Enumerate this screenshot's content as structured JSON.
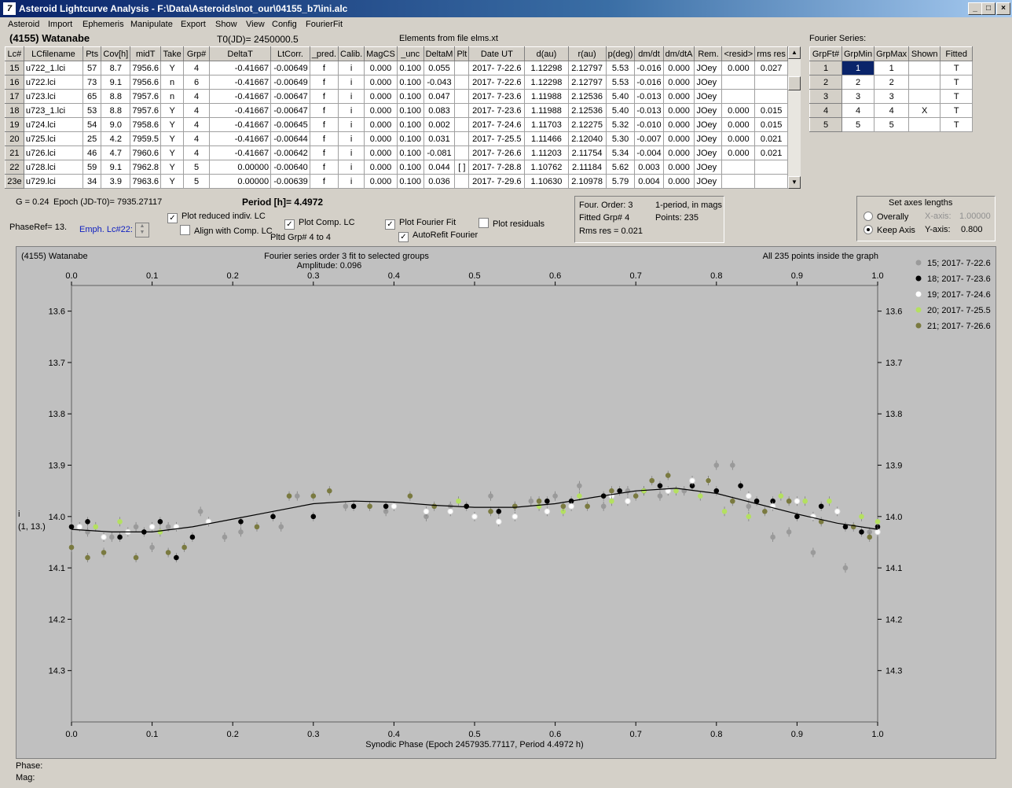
{
  "window": {
    "title": "Asteroid Lightcurve Analysis - F:\\Data\\Asteroids\\not_our\\04155_b7\\ini.alc"
  },
  "menu": [
    "Asteroid",
    "Import",
    "Ephemeris",
    "Manipulate",
    "Export",
    "Show",
    "View",
    "Config",
    "FourierFit"
  ],
  "header": {
    "asteroid_name": "(4155) Watanabe",
    "t0": "T0(JD)= 2450000.5",
    "elements": "Elements from file elms.xt",
    "fourier_label": "Fourier Series:"
  },
  "lc_table": {
    "columns": [
      "Lc#",
      "LCfilename",
      "Pts",
      "Cov[h]",
      "midT",
      "Take",
      "Grp#",
      "DeltaT",
      "LtCorr.",
      "_pred.",
      "Calib.",
      "MagCS",
      "_unc",
      "DeltaM",
      "Plt",
      "Date UT",
      "d(au)",
      "r(au)",
      "p(deg)",
      "dm/dt",
      "dm/dtA",
      "Rem.",
      "<resid>",
      "rms res"
    ],
    "rows": [
      [
        "15",
        "u722_1.lci",
        "57",
        "8.7",
        "7956.6",
        "Y",
        "4",
        "-0.41667",
        "-0.00649",
        "f",
        "i",
        "0.000",
        "0.100",
        "0.055",
        "",
        "2017- 7-22.6",
        "1.12298",
        "2.12797",
        "5.53",
        "-0.016",
        "0.000",
        "JOey",
        "0.000",
        "0.027"
      ],
      [
        "16",
        "u722.lci",
        "73",
        "9.1",
        "7956.6",
        "n",
        "6",
        "-0.41667",
        "-0.00649",
        "f",
        "i",
        "0.000",
        "0.100",
        "-0.043",
        "",
        "2017- 7-22.6",
        "1.12298",
        "2.12797",
        "5.53",
        "-0.016",
        "0.000",
        "JOey",
        "",
        ""
      ],
      [
        "17",
        "u723.lci",
        "65",
        "8.8",
        "7957.6",
        "n",
        "4",
        "-0.41667",
        "-0.00647",
        "f",
        "i",
        "0.000",
        "0.100",
        "0.047",
        "",
        "2017- 7-23.6",
        "1.11988",
        "2.12536",
        "5.40",
        "-0.013",
        "0.000",
        "JOey",
        "",
        ""
      ],
      [
        "18",
        "u723_1.lci",
        "53",
        "8.8",
        "7957.6",
        "Y",
        "4",
        "-0.41667",
        "-0.00647",
        "f",
        "i",
        "0.000",
        "0.100",
        "0.083",
        "",
        "2017- 7-23.6",
        "1.11988",
        "2.12536",
        "5.40",
        "-0.013",
        "0.000",
        "JOey",
        "0.000",
        "0.015"
      ],
      [
        "19",
        "u724.lci",
        "54",
        "9.0",
        "7958.6",
        "Y",
        "4",
        "-0.41667",
        "-0.00645",
        "f",
        "i",
        "0.000",
        "0.100",
        "0.002",
        "",
        "2017- 7-24.6",
        "1.11703",
        "2.12275",
        "5.32",
        "-0.010",
        "0.000",
        "JOey",
        "0.000",
        "0.015"
      ],
      [
        "20",
        "u725.lci",
        "25",
        "4.2",
        "7959.5",
        "Y",
        "4",
        "-0.41667",
        "-0.00644",
        "f",
        "i",
        "0.000",
        "0.100",
        "0.031",
        "",
        "2017- 7-25.5",
        "1.11466",
        "2.12040",
        "5.30",
        "-0.007",
        "0.000",
        "JOey",
        "0.000",
        "0.021"
      ],
      [
        "21",
        "u726.lci",
        "46",
        "4.7",
        "7960.6",
        "Y",
        "4",
        "-0.41667",
        "-0.00642",
        "f",
        "i",
        "0.000",
        "0.100",
        "-0.081",
        "",
        "2017- 7-26.6",
        "1.11203",
        "2.11754",
        "5.34",
        "-0.004",
        "0.000",
        "JOey",
        "0.000",
        "0.021"
      ],
      [
        "22",
        "u728.lci",
        "59",
        "9.1",
        "7962.8",
        "Y",
        "5",
        "0.00000",
        "-0.00640",
        "f",
        "i",
        "0.000",
        "0.100",
        "0.044",
        "[ ]",
        "2017- 7-28.8",
        "1.10762",
        "2.11184",
        "5.62",
        "0.003",
        "0.000",
        "JOey",
        "",
        ""
      ],
      [
        "23e",
        "u729.lci",
        "34",
        "3.9",
        "7963.6",
        "Y",
        "5",
        "0.00000",
        "-0.00639",
        "f",
        "i",
        "0.000",
        "0.100",
        "0.036",
        "",
        "2017- 7-29.6",
        "1.10630",
        "2.10978",
        "5.79",
        "0.004",
        "0.000",
        "JOey",
        "",
        ""
      ]
    ]
  },
  "fourier_table": {
    "columns": [
      "GrpFt#",
      "GrpMin",
      "GrpMax",
      "Shown",
      "Fitted"
    ],
    "rows": [
      [
        "1",
        "1",
        "1",
        "",
        "T"
      ],
      [
        "2",
        "2",
        "2",
        "",
        "T"
      ],
      [
        "3",
        "3",
        "3",
        "",
        "T"
      ],
      [
        "4",
        "4",
        "4",
        "X",
        "T"
      ],
      [
        "5",
        "5",
        "5",
        "",
        "T"
      ]
    ]
  },
  "controls": {
    "g": "G = 0.24",
    "epoch": "Epoch (JD-T0)= 7935.27117",
    "period": "Period [h]= 4.4972",
    "phaseref": "PhaseRef= 13.",
    "emph": "Emph. Lc#22:",
    "plot_reduced": "Plot reduced indiv. LC",
    "align_comp": "Align with Comp. LC",
    "plot_comp": "Plot Comp. LC",
    "pltd_grp": "Pltd Grp#  4  to   4",
    "plot_fourier": "Plot Fourier Fit",
    "autorefit": "AutoRefit Fourier",
    "plot_residuals": "Plot residuals",
    "four_order": "Four. Order:  3",
    "one_period": "1-period, in mags",
    "fitted_grp": "Fitted Grp# 4",
    "points": "Points: 235",
    "rms": "Rms res     = 0.021",
    "axes_title": "Set axes lengths",
    "overally": "Overally",
    "keep_axis": "Keep Axis",
    "x_axis_label": "X-axis:",
    "x_axis_value": "1.00000",
    "y_axis_label": "Y-axis:",
    "y_axis_value": "0.800"
  },
  "plot": {
    "name": "(4155) Watanabe",
    "fit_title": "Fourier series order 3 fit to selected groups",
    "amplitude": "Amplitude: 0.096",
    "inside": "All 235 points inside the graph",
    "xlabel": "Synodic Phase (Epoch 2457935.77117, Period 4.4972 h)",
    "ylabel_1": "i",
    "ylabel_2": "(1, 13.)"
  },
  "footer": {
    "phase": "Phase:",
    "mag": "Mag:"
  },
  "colors": {
    "selected": "#0a246a",
    "fit_line": "#000000"
  },
  "chart_data": {
    "type": "scatter",
    "xlim": [
      0,
      1
    ],
    "ylim": [
      14.4,
      13.55
    ],
    "xticks": [
      "0.0",
      "0.1",
      "0.2",
      "0.3",
      "0.4",
      "0.5",
      "0.6",
      "0.7",
      "0.8",
      "0.9",
      "1.0"
    ],
    "yticks": [
      "13.6",
      "13.7",
      "13.8",
      "13.9",
      "14.0",
      "14.1",
      "14.2",
      "14.3"
    ],
    "series": [
      {
        "name": "15; 2017- 7-22.6",
        "color": "#9a9a9a",
        "points": [
          [
            0.02,
            14.03
          ],
          [
            0.05,
            14.04
          ],
          [
            0.08,
            14.02
          ],
          [
            0.1,
            14.06
          ],
          [
            0.12,
            14.02
          ],
          [
            0.16,
            13.99
          ],
          [
            0.19,
            14.04
          ],
          [
            0.21,
            14.03
          ],
          [
            0.26,
            14.02
          ],
          [
            0.28,
            13.96
          ],
          [
            0.34,
            13.98
          ],
          [
            0.39,
            13.99
          ],
          [
            0.44,
            14.0
          ],
          [
            0.47,
            13.98
          ],
          [
            0.52,
            13.96
          ],
          [
            0.55,
            13.98
          ],
          [
            0.57,
            13.97
          ],
          [
            0.6,
            13.96
          ],
          [
            0.63,
            13.94
          ],
          [
            0.66,
            13.98
          ],
          [
            0.69,
            13.95
          ],
          [
            0.73,
            13.96
          ],
          [
            0.76,
            13.95
          ],
          [
            0.8,
            13.9
          ],
          [
            0.82,
            13.9
          ],
          [
            0.84,
            13.98
          ],
          [
            0.87,
            14.04
          ],
          [
            0.89,
            14.03
          ],
          [
            0.92,
            14.07
          ],
          [
            0.96,
            14.1
          ],
          [
            0.99,
            14.03
          ]
        ]
      },
      {
        "name": "18; 2017- 7-23.6",
        "color": "#000000",
        "points": [
          [
            0.0,
            14.02
          ],
          [
            0.02,
            14.01
          ],
          [
            0.06,
            14.04
          ],
          [
            0.09,
            14.03
          ],
          [
            0.11,
            14.01
          ],
          [
            0.13,
            14.08
          ],
          [
            0.15,
            14.04
          ],
          [
            0.21,
            14.01
          ],
          [
            0.25,
            14.0
          ],
          [
            0.3,
            14.0
          ],
          [
            0.35,
            13.98
          ],
          [
            0.39,
            13.98
          ],
          [
            0.49,
            13.98
          ],
          [
            0.53,
            13.99
          ],
          [
            0.59,
            13.97
          ],
          [
            0.62,
            13.97
          ],
          [
            0.66,
            13.96
          ],
          [
            0.68,
            13.95
          ],
          [
            0.71,
            13.95
          ],
          [
            0.73,
            13.94
          ],
          [
            0.77,
            13.94
          ],
          [
            0.8,
            13.95
          ],
          [
            0.83,
            13.94
          ],
          [
            0.85,
            13.97
          ],
          [
            0.87,
            13.97
          ],
          [
            0.9,
            14.0
          ],
          [
            0.93,
            13.98
          ],
          [
            0.96,
            14.02
          ],
          [
            0.98,
            14.03
          ],
          [
            1.0,
            14.02
          ]
        ]
      },
      {
        "name": "19; 2017- 7-24.6",
        "color": "#ffffff",
        "points": [
          [
            0.01,
            14.02
          ],
          [
            0.04,
            14.04
          ],
          [
            0.07,
            14.03
          ],
          [
            0.1,
            14.02
          ],
          [
            0.13,
            14.02
          ],
          [
            0.17,
            14.01
          ],
          [
            0.4,
            13.98
          ],
          [
            0.44,
            13.99
          ],
          [
            0.47,
            13.99
          ],
          [
            0.5,
            14.0
          ],
          [
            0.53,
            14.01
          ],
          [
            0.55,
            14.0
          ],
          [
            0.59,
            13.99
          ],
          [
            0.62,
            13.98
          ],
          [
            0.67,
            13.96
          ],
          [
            0.69,
            13.97
          ],
          [
            0.74,
            13.95
          ],
          [
            0.77,
            13.93
          ],
          [
            0.79,
            13.93
          ],
          [
            0.84,
            13.96
          ],
          [
            0.87,
            13.98
          ],
          [
            0.9,
            13.97
          ],
          [
            0.92,
            14.0
          ],
          [
            0.95,
            13.99
          ],
          [
            1.0,
            14.03
          ]
        ]
      },
      {
        "name": "20; 2017- 7-25.5",
        "color": "#b4e060",
        "points": [
          [
            0.03,
            14.02
          ],
          [
            0.06,
            14.01
          ],
          [
            0.11,
            14.03
          ],
          [
            0.48,
            13.97
          ],
          [
            0.58,
            13.98
          ],
          [
            0.61,
            13.99
          ],
          [
            0.63,
            13.96
          ],
          [
            0.67,
            13.97
          ],
          [
            0.71,
            13.95
          ],
          [
            0.75,
            13.95
          ],
          [
            0.78,
            13.96
          ],
          [
            0.81,
            13.99
          ],
          [
            0.84,
            14.0
          ],
          [
            0.88,
            13.96
          ],
          [
            0.91,
            13.97
          ],
          [
            0.94,
            13.97
          ],
          [
            0.98,
            14.0
          ],
          [
            1.0,
            14.01
          ]
        ]
      },
      {
        "name": "21; 2017- 7-26.6",
        "color": "#7a7a40",
        "points": [
          [
            0.0,
            14.06
          ],
          [
            0.02,
            14.08
          ],
          [
            0.04,
            14.07
          ],
          [
            0.08,
            14.08
          ],
          [
            0.12,
            14.07
          ],
          [
            0.14,
            14.06
          ],
          [
            0.23,
            14.02
          ],
          [
            0.27,
            13.96
          ],
          [
            0.3,
            13.96
          ],
          [
            0.32,
            13.95
          ],
          [
            0.37,
            13.98
          ],
          [
            0.42,
            13.96
          ],
          [
            0.45,
            13.98
          ],
          [
            0.52,
            13.99
          ],
          [
            0.55,
            13.98
          ],
          [
            0.58,
            13.97
          ],
          [
            0.61,
            13.98
          ],
          [
            0.64,
            13.98
          ],
          [
            0.67,
            13.95
          ],
          [
            0.7,
            13.96
          ],
          [
            0.72,
            13.93
          ],
          [
            0.74,
            13.92
          ],
          [
            0.79,
            13.93
          ],
          [
            0.82,
            13.97
          ],
          [
            0.86,
            13.99
          ],
          [
            0.89,
            13.97
          ],
          [
            0.93,
            14.01
          ],
          [
            0.97,
            14.02
          ],
          [
            0.99,
            14.04
          ]
        ]
      }
    ],
    "fit_line": {
      "name": "Fourier fit",
      "x": [
        0.0,
        0.05,
        0.1,
        0.15,
        0.2,
        0.25,
        0.3,
        0.35,
        0.4,
        0.45,
        0.5,
        0.55,
        0.6,
        0.65,
        0.7,
        0.75,
        0.8,
        0.85,
        0.9,
        0.95,
        1.0
      ],
      "y": [
        14.025,
        14.03,
        14.03,
        14.02,
        14.005,
        13.99,
        13.975,
        13.97,
        13.972,
        13.978,
        13.982,
        13.982,
        13.975,
        13.962,
        13.95,
        13.945,
        13.955,
        13.975,
        13.995,
        14.013,
        14.025
      ]
    }
  }
}
